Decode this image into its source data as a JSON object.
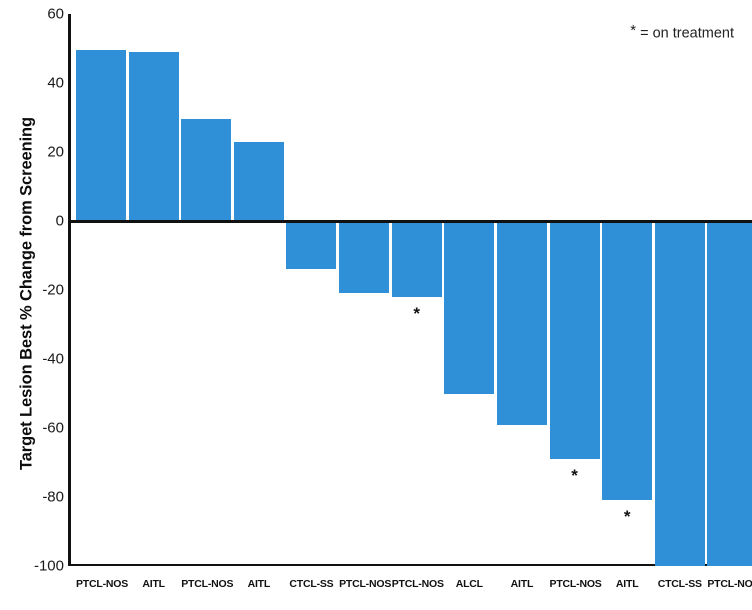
{
  "legend": {
    "symbol": "*",
    "text": "= on treatment"
  },
  "axes": {
    "y_title": "Target Lesion Best % Change from Screening",
    "y_ticks": [
      "60",
      "40",
      "20",
      "0",
      "-20",
      "-40",
      "-60",
      "-80",
      "-100"
    ]
  },
  "chart_data": {
    "type": "bar",
    "title": "",
    "subtitle": "",
    "xlabel": "",
    "ylabel": "Target Lesion Best % Change from Screening",
    "ylim": [
      -100,
      60
    ],
    "ytick_values": [
      60,
      40,
      20,
      0,
      -20,
      -40,
      -60,
      -80,
      -100
    ],
    "grid": false,
    "legend_position": "top-right",
    "legend_entries": [
      "* = on treatment"
    ],
    "bar_color": "#2f90d8",
    "axis_color": "#111111",
    "orientation": "waterfall-descending",
    "categories": [
      "PTCL-NOS",
      "AITL",
      "PTCL-NOS",
      "AITL",
      "CTCL-SS",
      "PTCL-NOS",
      "PTCL-NOS",
      "ALCL",
      "AITL",
      "PTCL-NOS",
      "AITL",
      "CTCL-SS",
      "PTCL-NOS"
    ],
    "values": [
      49.5,
      49,
      29.5,
      23,
      -14,
      -21,
      -22,
      -50,
      -59,
      -69,
      -81,
      -100,
      -100
    ],
    "annotations": [
      {
        "index": 6,
        "symbol": "*",
        "meaning": "on treatment"
      },
      {
        "index": 9,
        "symbol": "*",
        "meaning": "on treatment"
      },
      {
        "index": 10,
        "symbol": "*",
        "meaning": "on treatment"
      }
    ]
  }
}
